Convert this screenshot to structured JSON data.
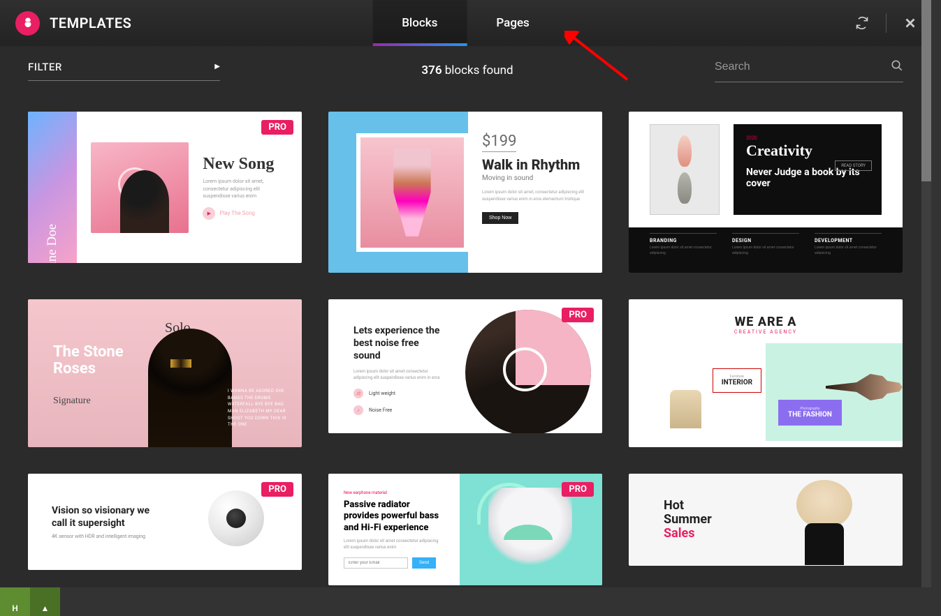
{
  "header": {
    "title": "TEMPLATES",
    "tabs": {
      "blocks": "Blocks",
      "pages": "Pages"
    }
  },
  "subheader": {
    "filter_label": "FILTER",
    "results_count": "376",
    "results_suffix": " blocks found",
    "search_placeholder": "Search"
  },
  "badges": {
    "pro": "PRO"
  },
  "cards": {
    "c1": {
      "artist": "Jane Doe",
      "title": "New Song",
      "lorem": "Lorem ipsum dolor sit amet, consectetur adipiscing elit suspendisse varius enim",
      "play": "Play The Song"
    },
    "c2": {
      "price": "$199",
      "title": "Walk in Rhythm",
      "sub": "Moving in sound",
      "lorem": "Lorem ipsum dolor sit amet, consectetur adipiscing elit suspendisse varius enim in eros elementum tristique",
      "cta": "Shop Now"
    },
    "c3": {
      "year": "2020",
      "title": "Creativity",
      "headline": "Never Judge a book by its cover",
      "cta": "READ STORY",
      "cols": [
        {
          "h": "BRANDING",
          "p": "Lorem ipsum dolor sit amet consectetur adipiscing"
        },
        {
          "h": "DESIGN",
          "p": "Lorem ipsum dolor sit amet consectetur adipiscing"
        },
        {
          "h": "DEVELOPMENT",
          "p": "Lorem ipsum dolor sit amet consectetur adipiscing"
        }
      ]
    },
    "c4": {
      "solo": "Solo",
      "title": "The Stone Roses",
      "signature": "Signature",
      "meta": "I WANNA BE ADORED SHE BANGS THE DRUMS WATERFALL BYE BYE BAD MAN ELIZABETH MY DEAR SHOOT YOU DOWN THIS IS THE ONE"
    },
    "c5": {
      "title": "Lets experience the best noise free sound",
      "lorem": "Lorem ipsum dolor sit amet consectetur adipiscing elit suspendisse varius enim in eros",
      "feat1": "Light weight",
      "feat2": "Noise Free"
    },
    "c6": {
      "title": "WE ARE A",
      "sub": "CREATIVE AGENCY",
      "box1_small": "Furniture",
      "box1": "INTERIOR",
      "box2_small": "Photography",
      "box2": "THE FASHION"
    },
    "c7": {
      "title": "Vision so visionary we call it supersight",
      "sub": "4K sensor with HDR and intelligent imaging"
    },
    "c8": {
      "eyebrow": "New earphone material",
      "title": "Passive radiator provides powerful bass and Hi-Fi experience",
      "lorem": "Lorem ipsum dolor sit amet consectetur adipiscing elit suspendisse varius enim",
      "placeholder": "Enter your Email",
      "cta": "Send"
    },
    "c9": {
      "l1": "Hot",
      "l2": "Summer",
      "l3": "Sales"
    }
  },
  "bottom": {
    "left": "H",
    "right": "▲"
  }
}
